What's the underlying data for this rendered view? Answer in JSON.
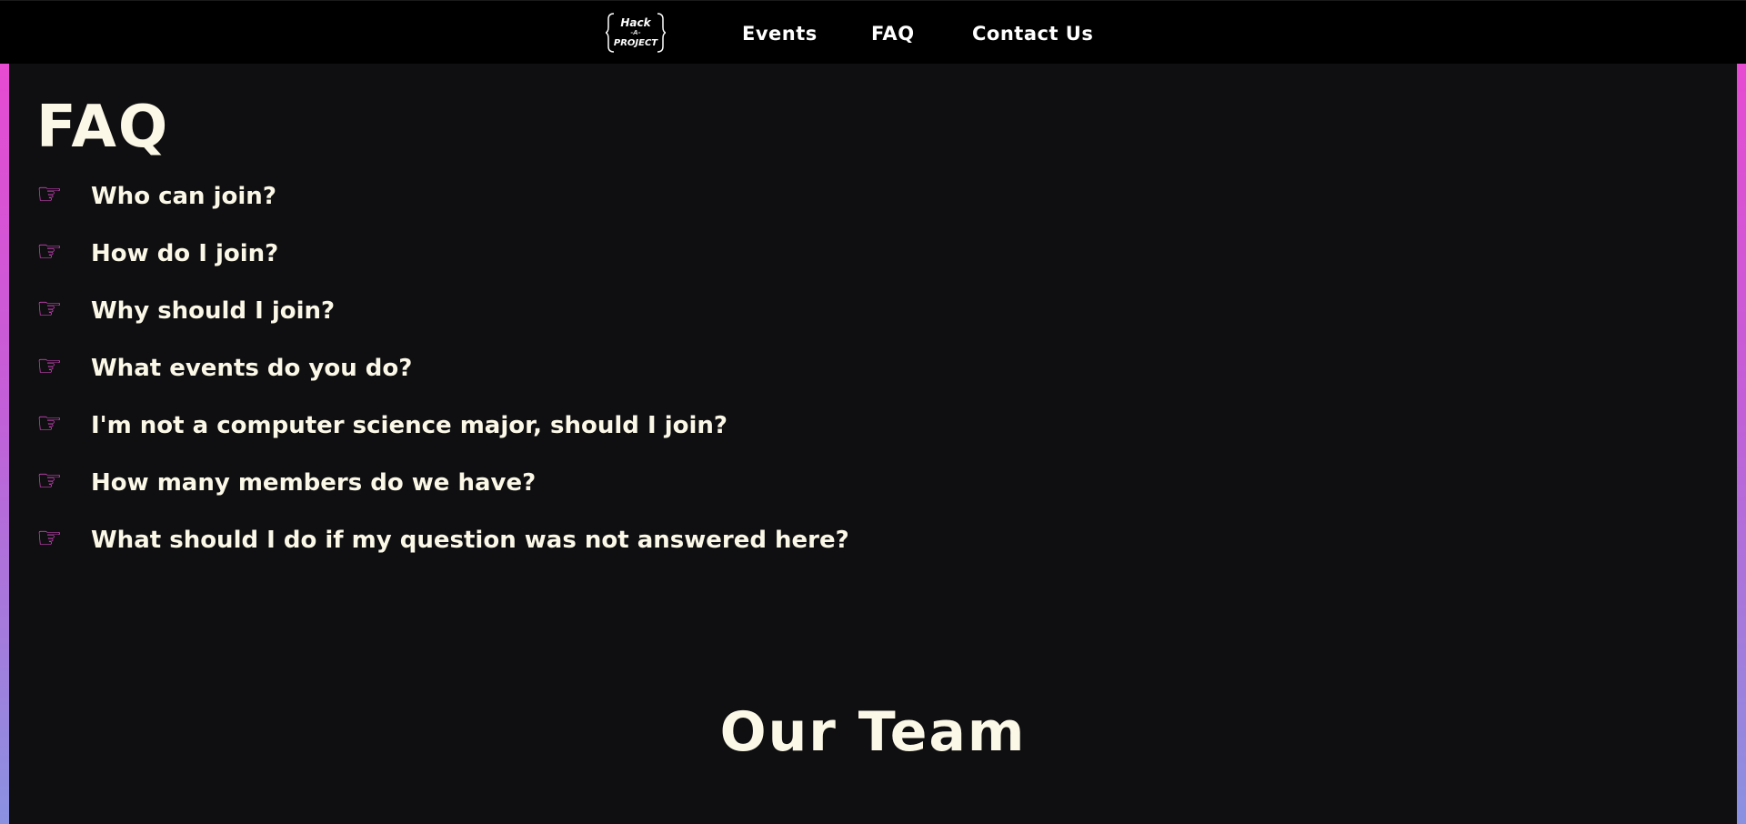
{
  "nav": {
    "logo": {
      "line1": "Hack",
      "line2": "-A-",
      "line3": "PROJECT"
    },
    "links": [
      "Events",
      "FAQ",
      "Contact Us"
    ]
  },
  "faq": {
    "title": "FAQ",
    "icon": "☞",
    "questions": [
      "Who can join?",
      "How do I join?",
      "Why should I join?",
      "What events do you do?",
      "I'm not a computer science major, should I join?",
      "How many members do we have?",
      "What should I do if my question was not answered here?"
    ]
  },
  "team": {
    "title": "Our Team"
  },
  "colors": {
    "background": "#0f0f11",
    "navbar": "#000000",
    "accent_pink": "#e64bd2",
    "accent_blue": "#8a92e0",
    "text": "#fbf8e8"
  }
}
